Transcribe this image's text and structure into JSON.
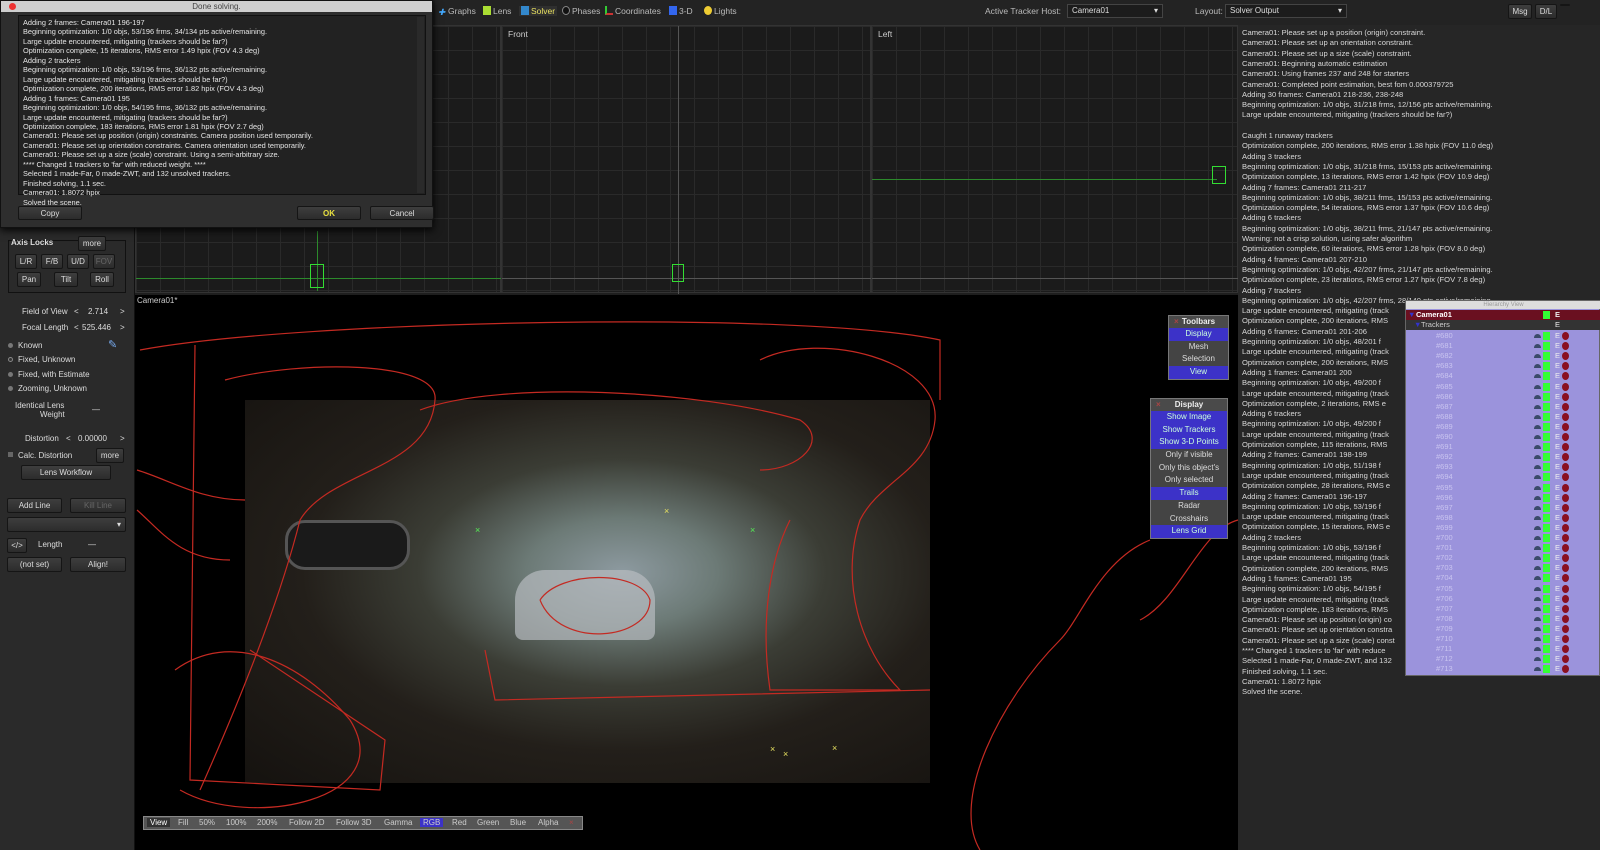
{
  "dialog": {
    "title": "Done solving.",
    "lines": [
      "Adding 2 frames:  Camera01 196-197",
      "Beginning optimization: 1/0 objs, 53/196 frms, 34/134 pts active/remaining.",
      "Large update encountered, mitigating (trackers should be far?)",
      "Optimization complete, 15 iterations, RMS error 1.49 hpix (FOV 4.3 deg)",
      "Adding 2 trackers",
      "Beginning optimization: 1/0 objs, 53/196 frms, 36/132 pts active/remaining.",
      "Large update encountered, mitigating (trackers should be far?)",
      "Optimization complete, 200 iterations, RMS error 1.82 hpix (FOV 4.3 deg)",
      "Adding 1 frames:  Camera01 195",
      "Beginning optimization: 1/0 objs, 54/195 frms, 36/132 pts active/remaining.",
      "Large update encountered, mitigating (trackers should be far?)",
      "Optimization complete, 183 iterations, RMS error 1.81 hpix (FOV 2.7 deg)",
      "Camera01: Please set up position (origin) constraints. Camera position used temporarily.",
      "Camera01: Please set up orientation constraints. Camera orientation used temporarily.",
      "Camera01: Please set up a size (scale) constraint. Using a semi-arbitrary size.",
      "**** Changed 1 trackers to 'far' with reduced weight. ****",
      "Selected 1 made-Far, 0 made-ZWT, and 132 unsolved trackers.",
      "Finished solving, 1.1 sec.",
      "Camera01: 1.8072 hpix",
      "Solved the scene."
    ],
    "copy": "Copy",
    "ok": "OK",
    "cancel": "Cancel"
  },
  "toolbar": {
    "tabs": [
      "Graphs",
      "Lens",
      "Solver",
      "Phases",
      "Coordinates",
      "3-D",
      "Lights"
    ],
    "active_tab": "Solver",
    "host_label": "Active Tracker Host:",
    "host_value": "Camera01",
    "layout_label": "Layout:",
    "layout_value": "Solver Output",
    "msg": "Msg",
    "dl": "D/L"
  },
  "viewports": {
    "front": "Front",
    "left": "Left",
    "main": "Camera01*"
  },
  "left_panel": {
    "axis_locks": "Axis Locks",
    "more": "more",
    "locks": [
      "L/R",
      "F/B",
      "U/D",
      "FOV",
      "Pan",
      "Tilt",
      "Roll"
    ],
    "fov_label": "Field of View",
    "fov_value": "2.714",
    "focal_label": "Focal Length",
    "focal_value": "525.446",
    "lens_modes": [
      "Known",
      "Fixed, Unknown",
      "Fixed, with Estimate",
      "Zooming, Unknown"
    ],
    "identical_lens": "Identical Lens",
    "weight": "Weight",
    "dash": "—",
    "distortion_label": "Distortion",
    "distortion_value": "0.00000",
    "calc_distortion": "Calc. Distortion",
    "more2": "more",
    "lens_workflow": "Lens Workflow",
    "add_line": "Add Line",
    "kill_line": "Kill Line",
    "code": "</>",
    "length": "Length",
    "not_set": "(not set)",
    "align": "Align!"
  },
  "toolbars_panel": {
    "title": "Toolbars",
    "items": [
      "Display",
      "Mesh",
      "Selection",
      "View"
    ],
    "active": [
      true,
      false,
      false,
      true
    ]
  },
  "display_panel": {
    "title": "Display",
    "items": [
      "Show Image",
      "Show Trackers",
      "Show 3-D Points",
      "Only if visible",
      "Only this object's",
      "Only selected",
      "Trails",
      "Radar",
      "Crosshairs",
      "Lens Grid"
    ],
    "active": [
      true,
      true,
      true,
      false,
      false,
      false,
      true,
      false,
      false,
      true
    ]
  },
  "bottom_bar": [
    "View",
    "Fill",
    "50%",
    "100%",
    "200%",
    "Follow 2D",
    "Follow 3D",
    "Gamma",
    "RGB",
    "Red",
    "Green",
    "Blue",
    "Alpha",
    "×"
  ],
  "log": [
    "Camera01: Please set up a position (origin) constraint.",
    "Camera01: Please set up an orientation constraint.",
    "Camera01: Please set up a size (scale) constraint.",
    "Camera01: Beginning automatic estimation",
    "Camera01: Using frames 237 and 248 for starters",
    "Camera01: Completed point estimation, best fom 0.000379725",
    "Adding 30 frames:  Camera01 218-236, 238-248",
    "Beginning optimization: 1/0 objs, 31/218 frms, 12/156 pts active/remaining.",
    "Large update encountered, mitigating (trackers should be far?)",
    "",
    "Caught 1 runaway trackers",
    "Optimization complete, 200 iterations, RMS error 1.38 hpix (FOV 11.0 deg)",
    "Adding 3 trackers",
    "Beginning optimization: 1/0 objs, 31/218 frms, 15/153 pts active/remaining.",
    "Optimization complete, 13 iterations, RMS error 1.42 hpix (FOV 10.9 deg)",
    "Adding 7 frames:  Camera01 211-217",
    "Beginning optimization: 1/0 objs, 38/211 frms, 15/153 pts active/remaining.",
    "Optimization complete, 54 iterations, RMS error 1.37 hpix (FOV 10.6 deg)",
    "Adding 6 trackers",
    "Beginning optimization: 1/0 objs, 38/211 frms, 21/147 pts active/remaining.",
    "Warning: not a crisp solution, using safer algorithm",
    "Optimization complete, 60 iterations, RMS error 1.28 hpix (FOV 8.0 deg)",
    "Adding 4 frames:  Camera01 207-210",
    "Beginning optimization: 1/0 objs, 42/207 frms, 21/147 pts active/remaining.",
    "Optimization complete, 23 iterations, RMS error 1.27 hpix (FOV 7.8 deg)",
    "Adding 7 trackers",
    "Beginning optimization: 1/0 objs, 42/207 frms, 28/140 pts active/remaining.",
    "Large update encountered, mitigating (track",
    "Optimization complete, 200 iterations, RMS",
    "Adding 6 frames:  Camera01 201-206",
    "Beginning optimization: 1/0 objs, 48/201 f",
    "Large update encountered, mitigating (track",
    "Optimization complete, 200 iterations, RMS",
    "Adding 1 frames:  Camera01 200",
    "Beginning optimization: 1/0 objs, 49/200 f",
    "Large update encountered, mitigating (track",
    "Optimization complete, 2 iterations, RMS e",
    "Adding 6 trackers",
    "Beginning optimization: 1/0 objs, 49/200 f",
    "Large update encountered, mitigating (track",
    "Optimization complete, 115 iterations, RMS",
    "Adding 2 frames:  Camera01 198-199",
    "Beginning optimization: 1/0 objs, 51/198 f",
    "Large update encountered, mitigating (track",
    "Optimization complete, 28 iterations, RMS e",
    "Adding 2 frames:  Camera01 196-197",
    "Beginning optimization: 1/0 objs, 53/196 f",
    "Large update encountered, mitigating (track",
    "Optimization complete, 15 iterations, RMS e",
    "Adding 2 trackers",
    "Beginning optimization: 1/0 objs, 53/196 f",
    "Large update encountered, mitigating (track",
    "Optimization complete, 200 iterations, RMS",
    "Adding 1 frames:  Camera01 195",
    "Beginning optimization: 1/0 objs, 54/195 f",
    "Large update encountered, mitigating (track",
    "Optimization complete, 183 iterations, RMS",
    "Camera01: Please set up position (origin) co",
    "Camera01: Please set up orientation constra",
    "Camera01: Please set up a size (scale) const",
    "**** Changed 1 trackers to 'far' with reduce",
    "Selected 1 made-Far, 0 made-ZWT, and 132",
    "Finished solving, 1.1 sec.",
    "Camera01: 1.8072 hpix",
    "Solved the scene."
  ],
  "hierarchy": {
    "title": "Hierarchy View",
    "camera": "Camera01",
    "group": "Trackers",
    "e": "E",
    "trackers": [
      "#680",
      "#681",
      "#682",
      "#683",
      "#684",
      "#685",
      "#686",
      "#687",
      "#688",
      "#689",
      "#690",
      "#691",
      "#692",
      "#693",
      "#694",
      "#695",
      "#696",
      "#697",
      "#698",
      "#699",
      "#700",
      "#701",
      "#702",
      "#703",
      "#704",
      "#705",
      "#706",
      "#707",
      "#708",
      "#709",
      "#710",
      "#711",
      "#712",
      "#713"
    ]
  }
}
